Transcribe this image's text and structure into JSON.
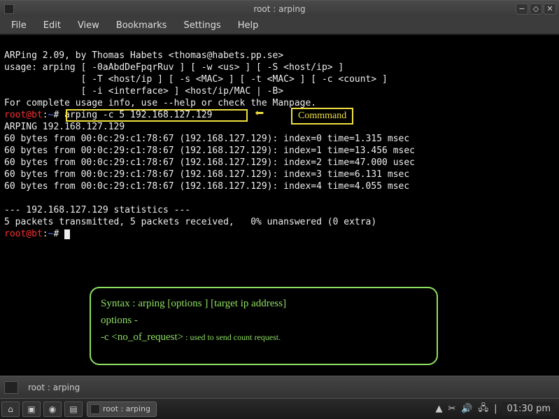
{
  "window": {
    "title": "root : arping",
    "controls": {
      "min": "−",
      "max": "◇",
      "close": "✕"
    }
  },
  "menu": [
    "File",
    "Edit",
    "View",
    "Bookmarks",
    "Settings",
    "Help"
  ],
  "terminal": {
    "banner": "ARPing 2.09, by Thomas Habets <thomas@habets.pp.se>",
    "usage1": "usage: arping [ -0aAbdDeFpqrRuv ] [ -w <us> ] [ -S <host/ip> ]",
    "usage2": "              [ -T <host/ip ] [ -s <MAC> ] [ -t <MAC> ] [ -c <count> ]",
    "usage3": "              [ -i <interface> ] <host/ip/MAC | -B>",
    "helpline": "For complete usage info, use --help or check the Manpage.",
    "prompt_user": "root@bt",
    "prompt_path": "~",
    "prompt_sep": ":",
    "prompt_end": "#",
    "cmd": "arping -c 5 192.168.127.129",
    "arping_line": "ARPING 192.168.127.129",
    "replies": [
      "60 bytes from 00:0c:29:c1:78:67 (192.168.127.129): index=0 time=1.315 msec",
      "60 bytes from 00:0c:29:c1:78:67 (192.168.127.129): index=1 time=13.456 msec",
      "60 bytes from 00:0c:29:c1:78:67 (192.168.127.129): index=2 time=47.000 usec",
      "60 bytes from 00:0c:29:c1:78:67 (192.168.127.129): index=3 time=6.131 msec",
      "60 bytes from 00:0c:29:c1:78:67 (192.168.127.129): index=4 time=4.055 msec"
    ],
    "stats1": "--- 192.168.127.129 statistics ---",
    "stats2": "5 packets transmitted, 5 packets received,   0% unanswered (0 extra)"
  },
  "annotations": {
    "command_label": "Commmand",
    "arrow": "⬅",
    "syntax_line1": "Syntax : arping [options ] [target ip address]",
    "syntax_line2": "options -",
    "syntax_line3a": "-c <no_of_request>",
    "syntax_line3b": " : used to send count request."
  },
  "window_tab": {
    "title": "root : arping"
  },
  "taskbar": {
    "task_title": "root : arping",
    "tray": {
      "cut": "✂",
      "vol": "🔊",
      "net": "🖧",
      "sep": "|"
    },
    "clock": "01:30 pm"
  }
}
